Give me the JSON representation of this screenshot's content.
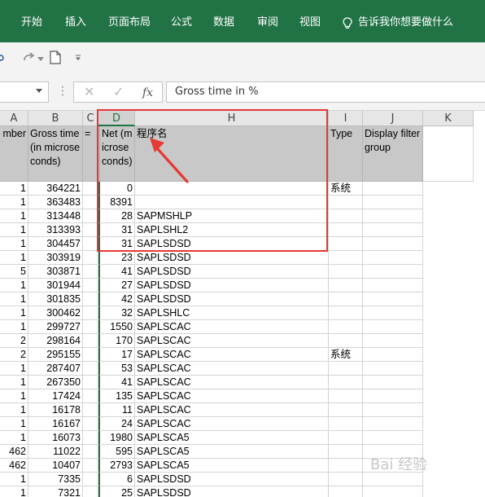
{
  "ribbon": {
    "tabs": [
      "开始",
      "插入",
      "页面布局",
      "公式",
      "数据",
      "审阅",
      "视图"
    ],
    "tell_me": "告诉我你想要做什么",
    "tell_me_icon": "lightbulb-icon",
    "background": "#217346"
  },
  "qat": {
    "icons": [
      "redo-icon",
      "redo-dropdown-icon",
      "new-document-icon",
      "customize-qat-icon"
    ]
  },
  "formula_bar": {
    "name_box": "",
    "cancel_glyph": "✕",
    "enter_glyph": "✓",
    "fx_label": "fx",
    "content": "Gross time in %"
  },
  "columns": [
    "A",
    "B",
    "C",
    "D",
    "H",
    "I",
    "J",
    "K"
  ],
  "selected_column": "D",
  "header_row": {
    "A": "mber",
    "B": "Gross time (in microseconds)",
    "C": "=",
    "D": "Net (microseconds)",
    "H": "程序名",
    "I": "Type",
    "J": "Display filter group"
  },
  "rows": [
    {
      "a": "1",
      "b": "364221",
      "d": "0",
      "h": "",
      "i": "系统"
    },
    {
      "a": "1",
      "b": "363483",
      "d": "8391",
      "h": "",
      "i": ""
    },
    {
      "a": "1",
      "b": "313448",
      "d": "28",
      "h": "SAPMSHLP",
      "i": ""
    },
    {
      "a": "1",
      "b": "313393",
      "d": "31",
      "h": "SAPLSHL2",
      "i": ""
    },
    {
      "a": "1",
      "b": "304457",
      "d": "31",
      "h": "SAPLSDSD",
      "i": ""
    },
    {
      "a": "1",
      "b": "303919",
      "d": "23",
      "h": "SAPLSDSD",
      "i": ""
    },
    {
      "a": "5",
      "b": "303871",
      "d": "41",
      "h": "SAPLSDSD",
      "i": ""
    },
    {
      "a": "1",
      "b": "301944",
      "d": "27",
      "h": "SAPLSDSD",
      "i": ""
    },
    {
      "a": "1",
      "b": "301835",
      "d": "42",
      "h": "SAPLSDSD",
      "i": ""
    },
    {
      "a": "1",
      "b": "300462",
      "d": "32",
      "h": "SAPLSHLC",
      "i": ""
    },
    {
      "a": "1",
      "b": "299727",
      "d": "1550",
      "h": "SAPLSCAC",
      "i": ""
    },
    {
      "a": "2",
      "b": "298164",
      "d": "170",
      "h": "SAPLSCAC",
      "i": ""
    },
    {
      "a": "2",
      "b": "295155",
      "d": "17",
      "h": "SAPLSCAC",
      "i": "系统"
    },
    {
      "a": "1",
      "b": "287407",
      "d": "53",
      "h": "SAPLSCAC",
      "i": ""
    },
    {
      "a": "1",
      "b": "267350",
      "d": "41",
      "h": "SAPLSCAC",
      "i": ""
    },
    {
      "a": "1",
      "b": "17424",
      "d": "135",
      "h": "SAPLSCAC",
      "i": ""
    },
    {
      "a": "1",
      "b": "16178",
      "d": "11",
      "h": "SAPLSCAC",
      "i": ""
    },
    {
      "a": "1",
      "b": "16167",
      "d": "24",
      "h": "SAPLSCAC",
      "i": ""
    },
    {
      "a": "1",
      "b": "16073",
      "d": "1980",
      "h": "SAPLSCA5",
      "i": ""
    },
    {
      "a": "462",
      "b": "11022",
      "d": "595",
      "h": "SAPLSCA5",
      "i": ""
    },
    {
      "a": "462",
      "b": "10407",
      "d": "2793",
      "h": "SAPLSCA5",
      "i": ""
    },
    {
      "a": "1",
      "b": "7335",
      "d": "6",
      "h": "SAPLSDSD",
      "i": ""
    },
    {
      "a": "1",
      "b": "7321",
      "d": "25",
      "h": "SAPLSDSD",
      "i": ""
    }
  ],
  "annotation": {
    "box_color": "#e53935",
    "arrow_color": "#e53935"
  },
  "watermark": "Bai 经验"
}
